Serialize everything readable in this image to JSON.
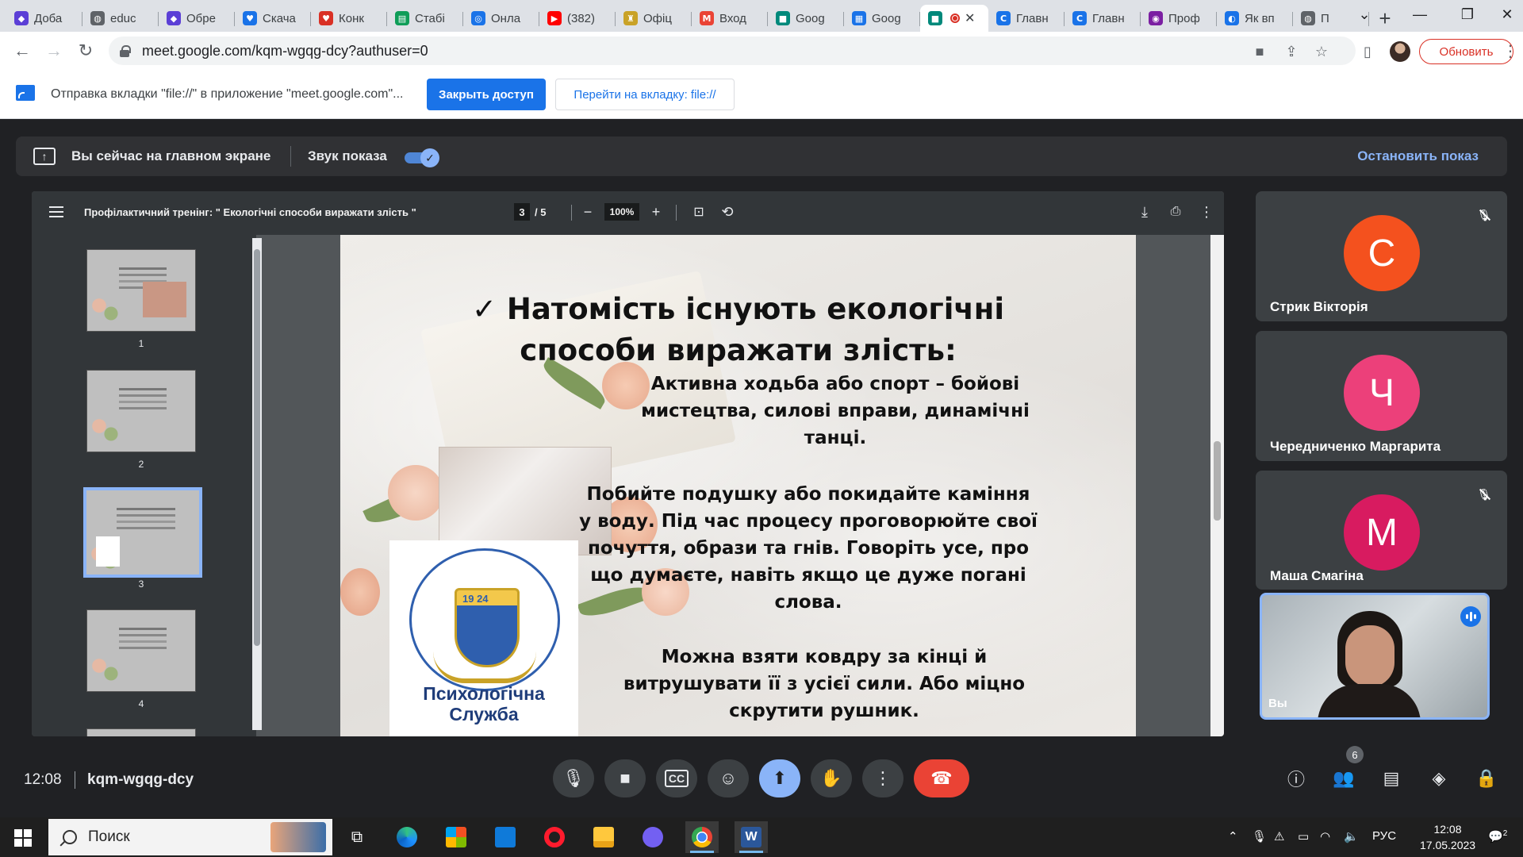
{
  "browser": {
    "tabs": [
      {
        "label": "Доба",
        "icon": "shield-icon",
        "color": "#5b3fd6"
      },
      {
        "label": "educ",
        "icon": "globe-icon",
        "color": "#5f6368"
      },
      {
        "label": "Обре",
        "icon": "shield-icon",
        "color": "#5b3fd6"
      },
      {
        "label": "Скача",
        "icon": "heart-icon",
        "color": "#1a73e8"
      },
      {
        "label": "Конк",
        "icon": "heart-icon",
        "color": "#d93025"
      },
      {
        "label": "Стабі",
        "icon": "sheets-icon",
        "color": "#0f9d58"
      },
      {
        "label": "Онла",
        "icon": "ring-icon",
        "color": "#1a73e8"
      },
      {
        "label": "(382)",
        "icon": "youtube-icon",
        "color": "#ff0000"
      },
      {
        "label": "Офіц",
        "icon": "crest-icon",
        "color": "#c9a227"
      },
      {
        "label": "Вход",
        "icon": "gmail-icon",
        "color": "#ea4335"
      },
      {
        "label": "Goog",
        "icon": "meet-icon",
        "color": "#00897b"
      },
      {
        "label": "Goog",
        "icon": "calendar-icon",
        "color": "#1a73e8"
      },
      {
        "label": "",
        "icon": "meet-icon",
        "color": "#00897b",
        "active": true
      },
      {
        "label": "Главн",
        "icon": "c-icon",
        "color": "#1a73e8"
      },
      {
        "label": "Главн",
        "icon": "c-icon",
        "color": "#1a73e8"
      },
      {
        "label": "Проф",
        "icon": "chat-icon",
        "color": "#7b1fa2"
      },
      {
        "label": "Як вп",
        "icon": "edge-icon",
        "color": "#1a73e8"
      },
      {
        "label": "П",
        "icon": "globe-icon",
        "color": "#5f6368"
      }
    ],
    "new_tab": "+",
    "url": "meet.google.com/kqm-wgqg-dcy?authuser=0",
    "update_label": "Обновить"
  },
  "infobar": {
    "message": "Отправка вкладки \"file://\" в приложение \"meet.google.com\"...",
    "stop_access": "Закрыть доступ",
    "goto_tab": "Перейти на вкладку: file://"
  },
  "share_banner": {
    "status": "Вы сейчас на главном экране",
    "audio_label": "Звук показа",
    "audio_on": true,
    "stop_label": "Остановить показ"
  },
  "pdf": {
    "title": "Профілактичний тренінг: \" Екологічні способи виражати злість \"",
    "current_page": "3",
    "page_total": "/ 5",
    "zoom": "100%",
    "thumbnails": [
      "1",
      "2",
      "3",
      "4"
    ],
    "selected_thumbnail": "3",
    "slide": {
      "heading_line1": "✓ Натомість існують екологічні",
      "heading_line2": "способи виражати злість:",
      "p1": "Активна ходьба або спорт – бойові мистецтва, силові вправи, динамічні танці.",
      "p2": "Побийте подушку або покидайте каміння у воду. Під час процесу проговорюйте свої почуття, образи та гнів. Говоріть усе, про що думаєте, навіть якщо це дуже погані слова.",
      "p3": "Можна взяти ковдру за кінці й витрушувати її з усієї сили. Або міцно скрутити рушник.",
      "logo_year": "19 24",
      "logo_text": "Психологічна Служба"
    }
  },
  "participants": [
    {
      "name": "Стрик Вікторія",
      "initial": "С",
      "color": "#f4511e",
      "muted": true
    },
    {
      "name": "Чередниченко Маргарита",
      "initial": "Ч",
      "color": "#ec407a",
      "muted": false
    },
    {
      "name": "Маша Смагіна",
      "initial": "М",
      "color": "#d81b60",
      "muted": true
    }
  ],
  "self": {
    "name": "Вы"
  },
  "meeting": {
    "time": "12:08",
    "code": "kqm-wgqg-dcy",
    "people_count": "6"
  },
  "taskbar": {
    "search_label": "Поиск",
    "lang": "РУС",
    "time": "12:08",
    "date": "17.05.2023",
    "notifications": "2"
  }
}
